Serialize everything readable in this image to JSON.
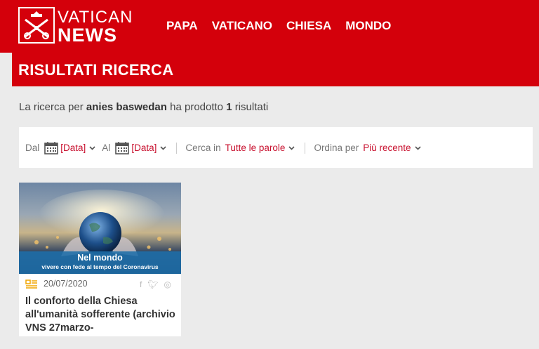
{
  "header": {
    "logo_top": "VATICAN",
    "logo_bottom": "NEWS",
    "nav": [
      "PAPA",
      "VATICANO",
      "CHIESA",
      "MONDO"
    ]
  },
  "page_title": "RISULTATI RICERCA",
  "summary": {
    "prefix": "La ricerca per",
    "query": "anies baswedan",
    "middle": "ha prodotto",
    "count": "1",
    "suffix": "risultati"
  },
  "filters": {
    "from_label": "Dal",
    "from_value": "[Data]",
    "to_label": "Al",
    "to_value": "[Data]",
    "search_in_label": "Cerca in",
    "search_in_value": "Tutte le parole",
    "order_label": "Ordina per",
    "order_value": "Più recente"
  },
  "results": [
    {
      "image_title": "Nel mondo",
      "image_subtitle": "vivere con fede al tempo del Coronavirus",
      "date": "20/07/2020",
      "title": "Il conforto della Chiesa all'umanità sofferente (archivio VNS 27marzo-"
    }
  ],
  "share_icons": [
    "facebook-icon",
    "twitter-icon",
    "whatsapp-icon"
  ],
  "colors": {
    "brand_red": "#d4000b",
    "link_red": "#c8102e",
    "background": "#ebebeb"
  }
}
